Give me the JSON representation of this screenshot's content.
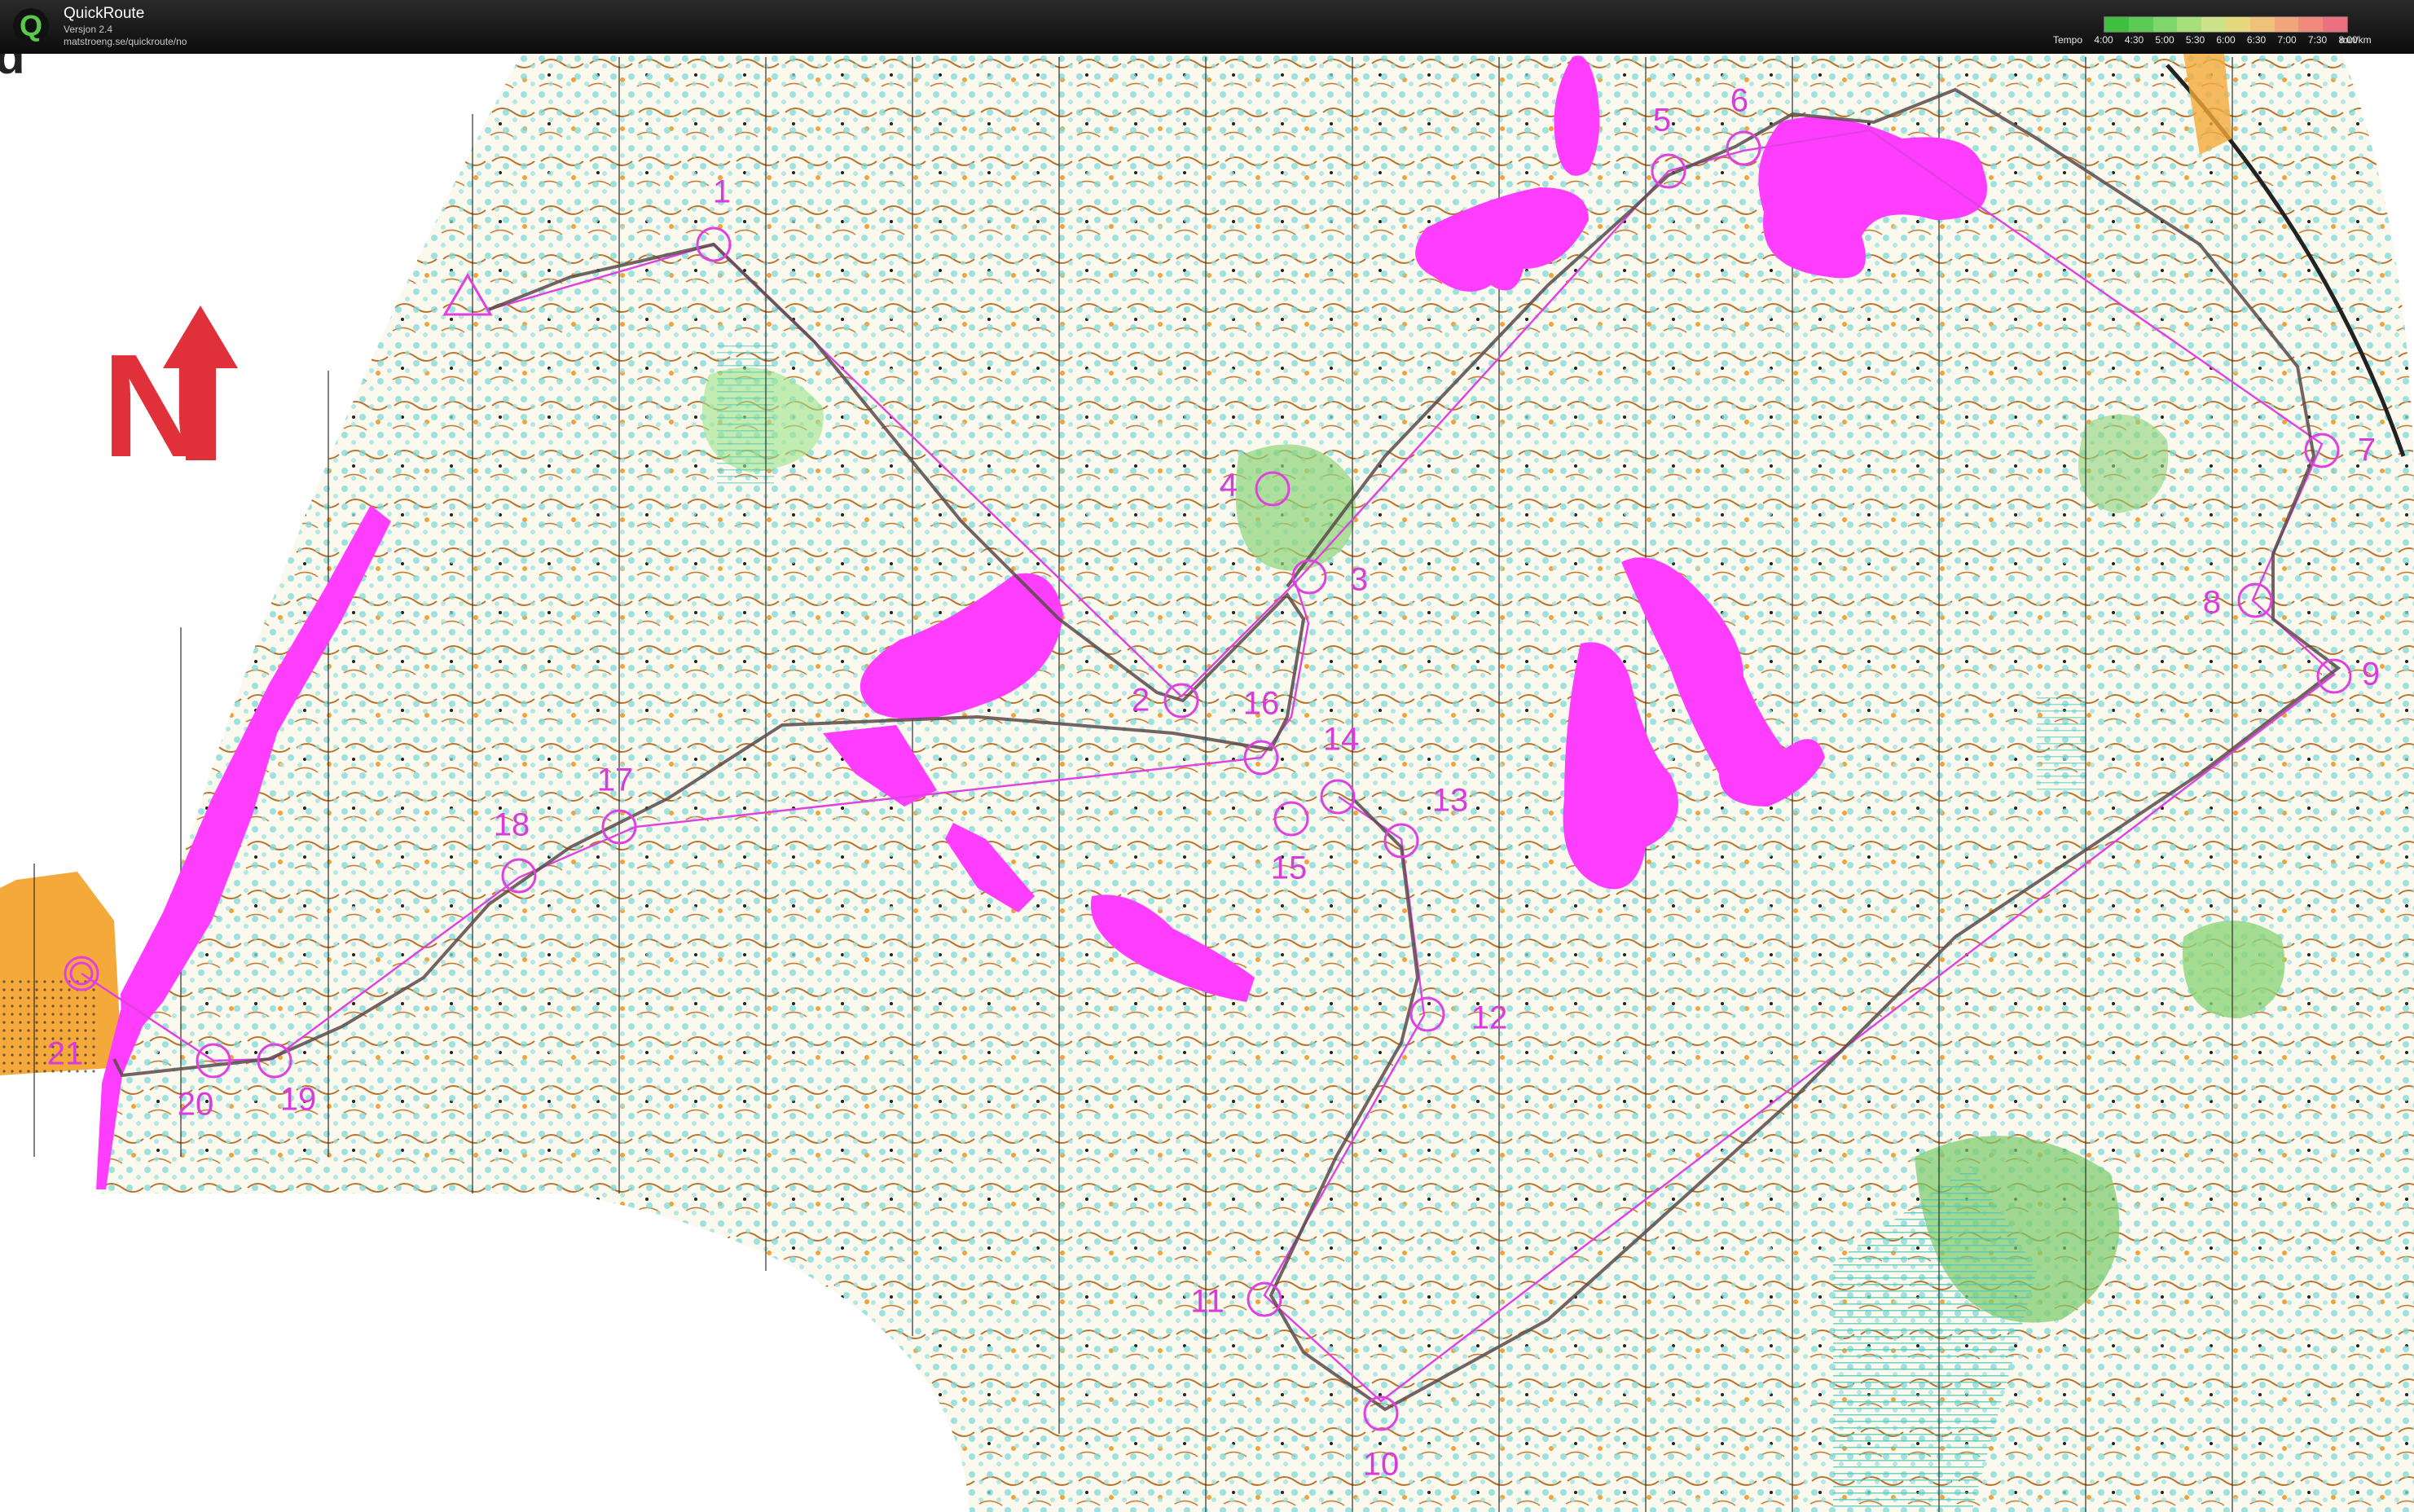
{
  "app": {
    "title": "QuickRoute",
    "version": "Versjon 2.4",
    "url": "matstroeng.se/quickroute/no",
    "logo_letter": "Q"
  },
  "tempo_legend": {
    "label": "Tempo",
    "ticks": [
      "4:00",
      "4:30",
      "5:00",
      "5:30",
      "6:00",
      "6:30",
      "7:00",
      "7:30",
      "8:00"
    ],
    "unit": "min/km",
    "colors": [
      "#3fbf3f",
      "#5ccb55",
      "#7fd66a",
      "#a7df7a",
      "#cde28a",
      "#e6d87e",
      "#efc27c",
      "#f0a57a",
      "#ef8a7c",
      "#eb7080"
    ]
  },
  "map": {
    "north_arrow_letter": "N",
    "corner_text": "d",
    "colors": {
      "course": "#e040e0",
      "route": "#5b4a4a",
      "forbidden": "#ff3dff",
      "north_arrow": "#e0303a",
      "open_land": "#f4a93a",
      "vegetation": "#68d8d8",
      "green": "#7acb6a",
      "contour": "#b06a28"
    },
    "controls": [
      {
        "number": "1"
      },
      {
        "number": "2"
      },
      {
        "number": "3"
      },
      {
        "number": "4"
      },
      {
        "number": "5"
      },
      {
        "number": "6"
      },
      {
        "number": "7"
      },
      {
        "number": "8"
      },
      {
        "number": "9"
      },
      {
        "number": "10"
      },
      {
        "number": "11"
      },
      {
        "number": "12"
      },
      {
        "number": "13"
      },
      {
        "number": "14"
      },
      {
        "number": "15"
      },
      {
        "number": "16"
      },
      {
        "number": "17"
      },
      {
        "number": "18"
      },
      {
        "number": "19"
      },
      {
        "number": "20"
      },
      {
        "number": "21"
      }
    ]
  }
}
